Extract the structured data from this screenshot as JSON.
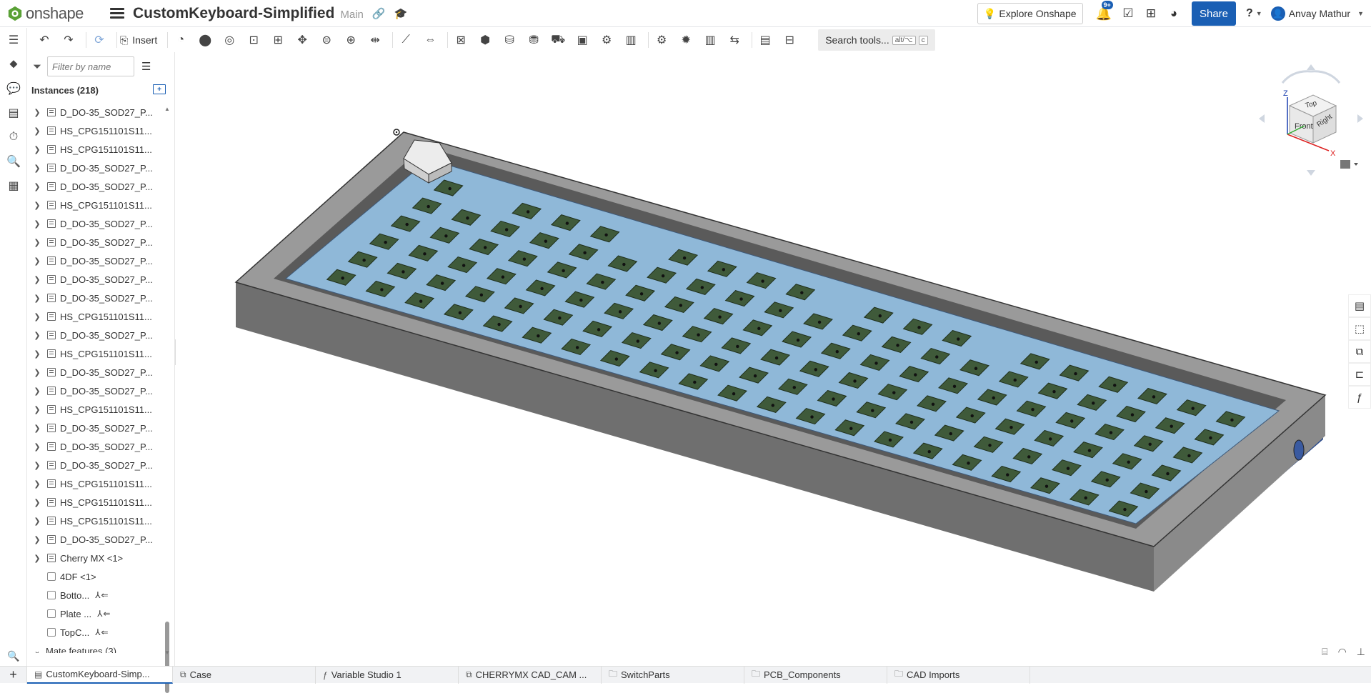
{
  "app": {
    "logo_text": "onshape"
  },
  "document": {
    "title": "CustomKeyboard-Simplified",
    "branch": "Main"
  },
  "topbar": {
    "explore_label": "Explore Onshape",
    "notification_badge": "9+",
    "share_label": "Share",
    "help_label": "?",
    "user_name": "Anvay Mathur"
  },
  "toolbar": {
    "insert_label": "Insert",
    "search_label": "Search tools...",
    "search_shortcut_1": "alt/⌥",
    "search_shortcut_2": "c"
  },
  "panel": {
    "filter_placeholder": "Filter by name",
    "instances_header": "Instances (218)",
    "items": [
      {
        "label": "D_DO-35_SOD27_P...",
        "type": "part"
      },
      {
        "label": "HS_CPG151101S11...",
        "type": "part"
      },
      {
        "label": "HS_CPG151101S11...",
        "type": "part"
      },
      {
        "label": "D_DO-35_SOD27_P...",
        "type": "part"
      },
      {
        "label": "D_DO-35_SOD27_P...",
        "type": "part"
      },
      {
        "label": "HS_CPG151101S11...",
        "type": "part"
      },
      {
        "label": "D_DO-35_SOD27_P...",
        "type": "part"
      },
      {
        "label": "D_DO-35_SOD27_P...",
        "type": "part"
      },
      {
        "label": "D_DO-35_SOD27_P...",
        "type": "part"
      },
      {
        "label": "D_DO-35_SOD27_P...",
        "type": "part"
      },
      {
        "label": "D_DO-35_SOD27_P...",
        "type": "part"
      },
      {
        "label": "HS_CPG151101S11...",
        "type": "part"
      },
      {
        "label": "D_DO-35_SOD27_P...",
        "type": "part"
      },
      {
        "label": "HS_CPG151101S11...",
        "type": "part"
      },
      {
        "label": "D_DO-35_SOD27_P...",
        "type": "part"
      },
      {
        "label": "D_DO-35_SOD27_P...",
        "type": "part"
      },
      {
        "label": "HS_CPG151101S11...",
        "type": "part"
      },
      {
        "label": "D_DO-35_SOD27_P...",
        "type": "part"
      },
      {
        "label": "D_DO-35_SOD27_P...",
        "type": "part"
      },
      {
        "label": "D_DO-35_SOD27_P...",
        "type": "part"
      },
      {
        "label": "HS_CPG151101S11...",
        "type": "part"
      },
      {
        "label": "HS_CPG151101S11...",
        "type": "part"
      },
      {
        "label": "HS_CPG151101S11...",
        "type": "part"
      },
      {
        "label": "D_DO-35_SOD27_P...",
        "type": "part"
      },
      {
        "label": "Cherry MX <1>",
        "type": "part"
      },
      {
        "label": "4DF <1>",
        "type": "mate-plain"
      },
      {
        "label": "Botto...",
        "type": "mate"
      },
      {
        "label": "Plate ...",
        "type": "mate"
      },
      {
        "label": "TopC...",
        "type": "mate"
      }
    ],
    "mate_features_label": "Mate features (3)"
  },
  "viewcube": {
    "top": "Top",
    "front": "Front",
    "right": "Right",
    "axis_x": "X",
    "axis_z": "Z"
  },
  "tabs": [
    {
      "label": "CustomKeyboard-Simp...",
      "icon": "assembly-icon",
      "active": true
    },
    {
      "label": "Case",
      "icon": "part-studio-icon",
      "active": false
    },
    {
      "label": "Variable Studio 1",
      "icon": "variable-studio-icon",
      "active": false
    },
    {
      "label": "CHERRYMX CAD_CAM ...",
      "icon": "part-studio-icon",
      "active": false
    },
    {
      "label": "SwitchParts",
      "icon": "folder-icon",
      "active": false
    },
    {
      "label": "PCB_Components",
      "icon": "folder-icon",
      "active": false
    },
    {
      "label": "CAD Imports",
      "icon": "folder-icon",
      "active": false
    }
  ],
  "colors": {
    "accent": "#1a5fb4",
    "pcb": "#8fb8d8",
    "case": "#6f6f6f",
    "base": "#2a4a8c",
    "switch": "#3f5a3a"
  }
}
